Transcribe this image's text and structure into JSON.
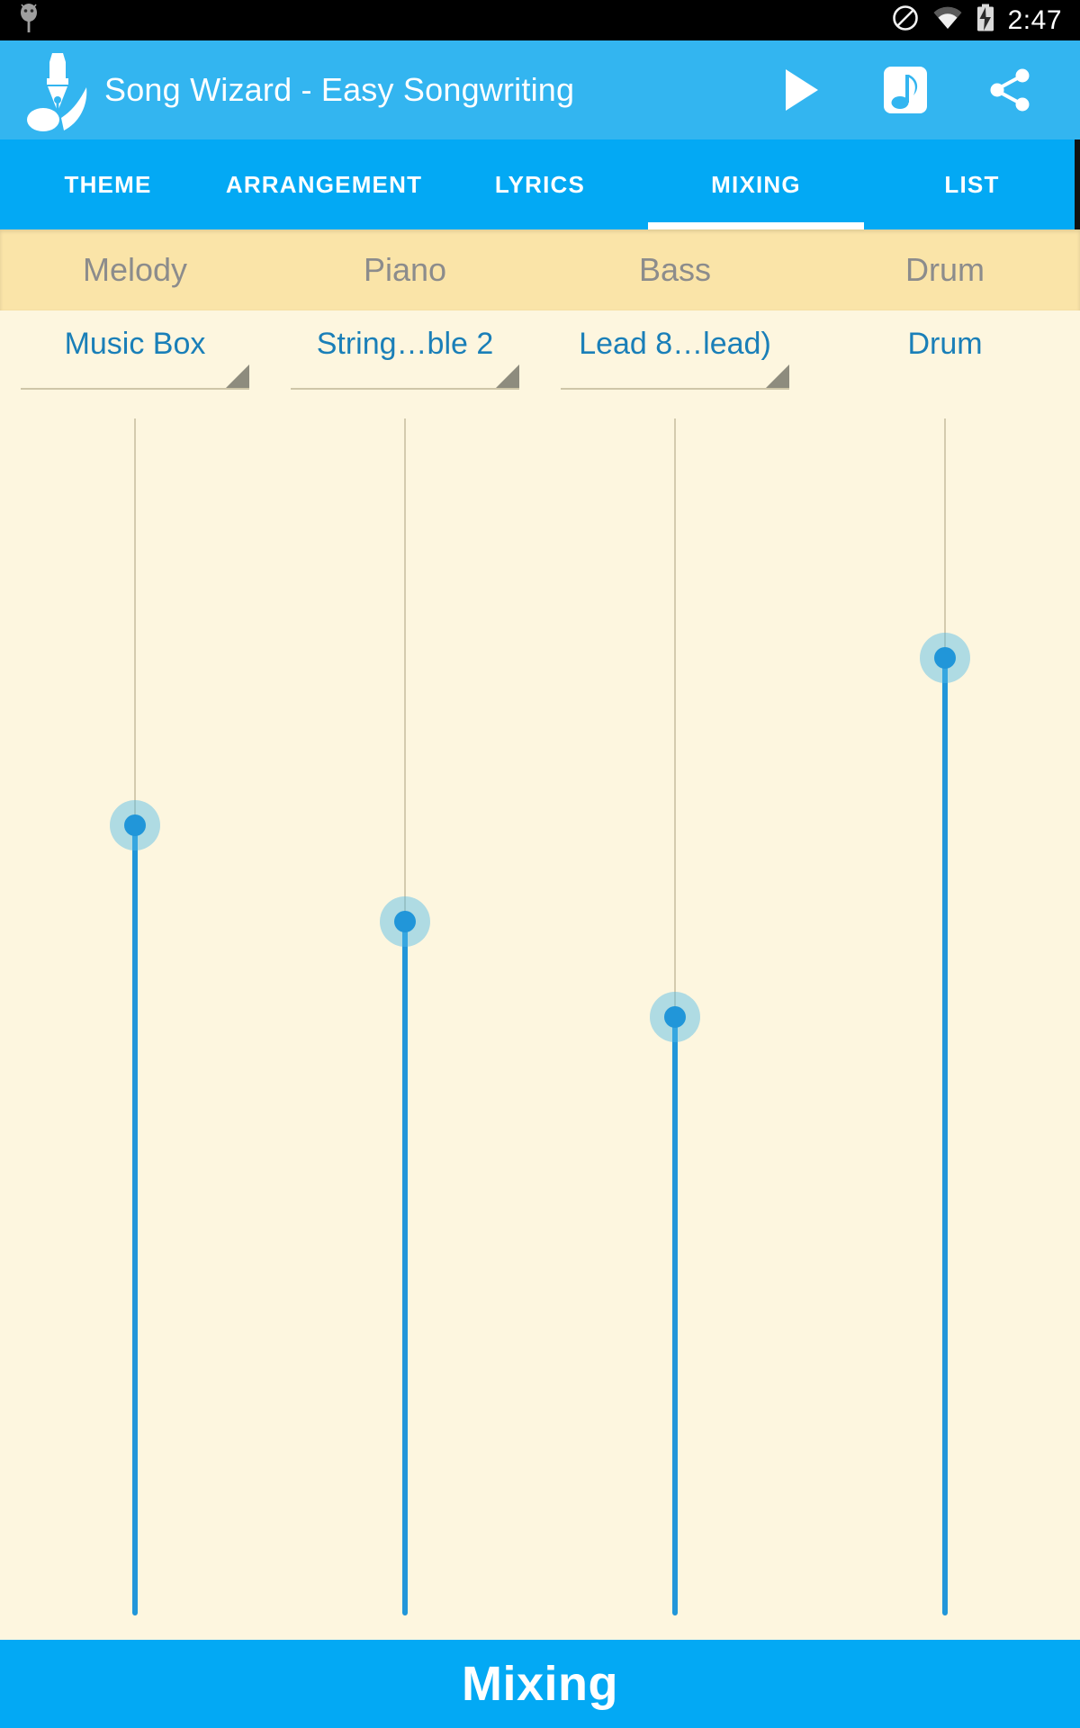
{
  "status_bar": {
    "time": "2:47",
    "icons": [
      "do-not-disturb-icon",
      "wifi-icon",
      "battery-charging-icon"
    ]
  },
  "app_bar": {
    "logo": "pen-nib-music-note-logo",
    "title": "Song Wizard - Easy Songwriting",
    "actions": [
      {
        "name": "play-button",
        "icon": "play-icon"
      },
      {
        "name": "music-note-button",
        "icon": "music-note-icon"
      },
      {
        "name": "share-button",
        "icon": "share-icon"
      }
    ]
  },
  "tabs": {
    "active": "MIXING",
    "items": [
      {
        "label": "THEME",
        "active": false
      },
      {
        "label": "ARRANGEMENT",
        "active": false
      },
      {
        "label": "LYRICS",
        "active": false
      },
      {
        "label": "MIXING",
        "active": true
      },
      {
        "label": "LIST",
        "active": false
      }
    ]
  },
  "categories": [
    {
      "label": "Melody"
    },
    {
      "label": "Piano"
    },
    {
      "label": "Bass"
    },
    {
      "label": "Drum"
    }
  ],
  "mixer": {
    "channels": [
      {
        "category": "Melody",
        "instrument": "Music Box",
        "has_dropdown": true,
        "volume_percent": 66
      },
      {
        "category": "Piano",
        "instrument": "String…ble 2",
        "has_dropdown": true,
        "volume_percent": 58
      },
      {
        "category": "Bass",
        "instrument": "Lead 8…lead)",
        "has_dropdown": true,
        "volume_percent": 50
      },
      {
        "category": "Drum",
        "instrument": "Drum",
        "has_dropdown": false,
        "volume_percent": 80
      }
    ]
  },
  "footer": {
    "label": "Mixing"
  },
  "colors": {
    "appbar_blue": "#33B5F0",
    "tab_blue": "#03A9F4",
    "band_cream": "#FAE4A8",
    "body_cream": "#FDF6DF",
    "slider_blue": "#2196D9",
    "spinner_text": "#1A7FB8",
    "category_text": "#8C8C8C"
  }
}
